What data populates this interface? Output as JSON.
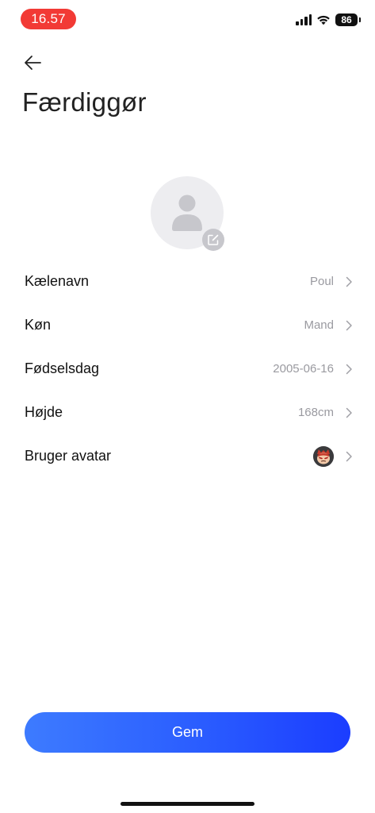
{
  "status_bar": {
    "time": "16.57",
    "battery": "86"
  },
  "header": {
    "title": "Færdiggør"
  },
  "profile": {
    "rows": [
      {
        "label": "Kælenavn",
        "value": "Poul"
      },
      {
        "label": "Køn",
        "value": "Mand"
      },
      {
        "label": "Fødselsdag",
        "value": "2005-06-16"
      },
      {
        "label": "Højde",
        "value": "168cm"
      },
      {
        "label": "Bruger avatar",
        "value": ""
      }
    ]
  },
  "footer": {
    "save_label": "Gem"
  },
  "colors": {
    "time_pill": "#f23a35",
    "button_gradient_start": "#3d7bff",
    "button_gradient_end": "#1b3dff",
    "value_text": "#9a9aa0"
  }
}
